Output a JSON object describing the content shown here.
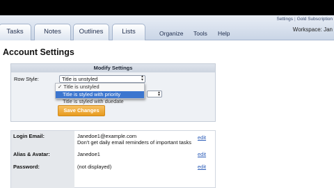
{
  "header": {
    "links": [
      "Settings",
      "Gold Subscription"
    ],
    "workspace_label": "Workspace: Jan"
  },
  "tabs": [
    {
      "label": "Tasks"
    },
    {
      "label": "Notes"
    },
    {
      "label": "Outlines"
    },
    {
      "label": "Lists"
    }
  ],
  "menu": [
    {
      "label": "Organize"
    },
    {
      "label": "Tools"
    },
    {
      "label": "Help"
    }
  ],
  "page": {
    "title": "Account Settings"
  },
  "modify": {
    "title": "Modify Settings",
    "row_style_label": "Row Style:",
    "row_style_value": "Title is unstyled",
    "options": [
      {
        "label": "✓ Title is unstyled",
        "selected": false
      },
      {
        "label": "Title is styled with priority",
        "selected": true
      },
      {
        "label": "Title is styled with duedate",
        "selected": false
      }
    ],
    "save_label": "Save Changes"
  },
  "account": {
    "rows": [
      {
        "label": "Login Email:",
        "value": "Janedoe1@example.com",
        "value2": "Don't get daily email reminders of important tasks",
        "edit": "edit"
      },
      {
        "label": "Alias & Avatar:",
        "value": "Janedoe1",
        "value2": "",
        "edit": "edit"
      },
      {
        "label": "Password:",
        "value": "(not displayed)",
        "value2": "",
        "edit": "edit"
      }
    ]
  },
  "colors": {
    "accent": "#e79b1f",
    "link": "#2a5bb8",
    "selection": "#3c76cf"
  }
}
